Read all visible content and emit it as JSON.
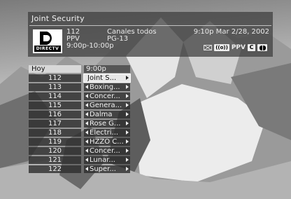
{
  "info_panel": {
    "title": "Joint Security",
    "logo_text": "DIRECTV",
    "channel": "112",
    "service": "PPV",
    "showtime": "9:00p-10:00p",
    "description": "Canales todos",
    "rating": "PG-13",
    "datetime": "9:10p Mar 2/28, 2002",
    "indicators": {
      "message": "envelope-icon",
      "dolby": "((o))",
      "ppv": "PPV",
      "closed_caption": "C",
      "dolby_digital": "dd-icon"
    }
  },
  "guide": {
    "channel_header": "Hoy",
    "time_header": "9:00p",
    "rows": [
      {
        "channel": "112",
        "program": "Joint S...",
        "selected": true
      },
      {
        "channel": "113",
        "program": "Boxing..."
      },
      {
        "channel": "114",
        "program": "Concer..."
      },
      {
        "channel": "115",
        "program": "Genera..."
      },
      {
        "channel": "116",
        "program": "Dalma"
      },
      {
        "channel": "117",
        "program": "Rose G..."
      },
      {
        "channel": "118",
        "program": "Electri..."
      },
      {
        "channel": "119",
        "program": "HZZO C..."
      },
      {
        "channel": "120",
        "program": "Concer..."
      },
      {
        "channel": "121",
        "program": "Lunar..."
      },
      {
        "channel": "122",
        "program": "Super..."
      }
    ]
  }
}
